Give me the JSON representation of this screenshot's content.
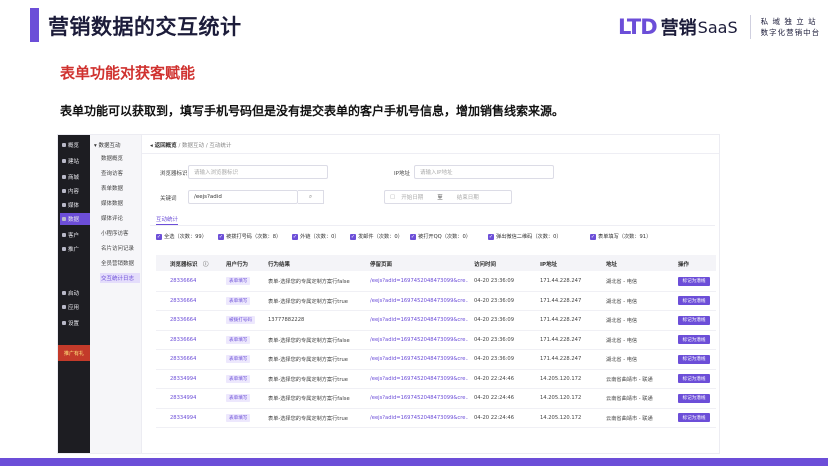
{
  "slide": {
    "title": "营销数据的交互统计",
    "section_title": "表单功能对获客赋能",
    "description": "表单功能可以获取到，填写手机号码但是没有提交表单的客户手机号信息，增加销售线索来源。"
  },
  "logo": {
    "ltd": "LTD",
    "brand": "营销",
    "saas": "SaaS",
    "tagline_1": "私 域 独 立 站",
    "tagline_2": "数字化营销中台"
  },
  "colors": {
    "accent": "#6c4ed8",
    "section_red": "#d0322f"
  },
  "app": {
    "sidebar": [
      {
        "label": "概览",
        "icon": "overview-icon"
      },
      {
        "label": "建站",
        "icon": "site-icon"
      },
      {
        "label": "商城",
        "icon": "shop-icon"
      },
      {
        "label": "内容",
        "icon": "content-icon"
      },
      {
        "label": "媒体",
        "icon": "media-icon"
      },
      {
        "label": "数据",
        "icon": "data-icon",
        "active": true
      },
      {
        "label": "客户",
        "icon": "customer-icon"
      },
      {
        "label": "推广",
        "icon": "promotion-icon"
      },
      {
        "label": "启动",
        "icon": "launch-icon"
      },
      {
        "label": "应用",
        "icon": "app-icon"
      },
      {
        "label": "设置",
        "icon": "settings-icon"
      }
    ],
    "promo_label": "推广有礼",
    "submenu_head": "▾ 数据互动",
    "submenu": [
      "数据概览",
      "查询访客",
      "表单数据",
      "媒体数据",
      "媒体评论",
      "小程序访客",
      "名片访问记录",
      "全员营销数据",
      "交互统计日志"
    ],
    "breadcrumb": {
      "back": "◂ 返回概览",
      "path1": "数据互动",
      "path2": "互动统计"
    },
    "filters": {
      "source_label": "浏览器标识",
      "source_placeholder": "请输入浏览器标识",
      "ip_label": "IP地址",
      "ip_placeholder": "请输入IP地址",
      "keyword_label": "关键词",
      "keyword_value": "/eejs?adid",
      "date_start": "开始日期",
      "date_sep": "至",
      "date_end": "结束日期"
    },
    "tab_label": "互动统计",
    "checks": [
      "全选（次数：99）",
      "被拨打号码（次数：8）",
      "外链（次数：0）",
      "发邮件（次数：0）",
      "被打开QQ（次数：0）",
      "弹出微信二维码（次数：0）",
      "表单填写（次数：91）"
    ],
    "columns": [
      "浏览器标识",
      "用户行为",
      "行为结果",
      "停留页面",
      "访问时间",
      "IP地址",
      "地址",
      "操作"
    ],
    "rows": [
      {
        "id": "28336664",
        "behavior": "表单填写",
        "result": "表单-选择您的专属定制方案行false",
        "page": "/eejs?adid=1697452048473099&cre...",
        "time": "04-20 23:36:09",
        "ip": "171.44.228.247",
        "addr": "湖北省 - 电信",
        "op": "标记为潜线"
      },
      {
        "id": "28336664",
        "behavior": "表单填写",
        "result": "表单-选择您的专属定制方案行true",
        "page": "/eejs?adid=1697452048473099&cre...",
        "time": "04-20 23:36:09",
        "ip": "171.44.228.247",
        "addr": "湖北省 - 电信",
        "op": "标记为潜线"
      },
      {
        "id": "28336664",
        "behavior": "被拨打号码",
        "result": "13777882228",
        "page": "/eejs?adid=1697452048473099&cre...",
        "time": "04-20 23:36:09",
        "ip": "171.44.228.247",
        "addr": "湖北省 - 电信",
        "op": "标记为潜线"
      },
      {
        "id": "28336664",
        "behavior": "表单填写",
        "result": "表单-选择您的专属定制方案行false",
        "page": "/eejs?adid=1697452048473099&cre...",
        "time": "04-20 23:36:09",
        "ip": "171.44.228.247",
        "addr": "湖北省 - 电信",
        "op": "标记为潜线"
      },
      {
        "id": "28336664",
        "behavior": "表单填写",
        "result": "表单-选择您的专属定制方案行true",
        "page": "/eejs?adid=1697452048473099&cre...",
        "time": "04-20 23:36:09",
        "ip": "171.44.228.247",
        "addr": "湖北省 - 电信",
        "op": "标记为潜线"
      },
      {
        "id": "28334994",
        "behavior": "表单填写",
        "result": "表单-选择您的专属定制方案行true",
        "page": "/eejs?adid=1697452048473099&cre...",
        "time": "04-20 22:24:46",
        "ip": "14.205.120.172",
        "addr": "云南省曲靖市 - 联通",
        "op": "标记为潜线"
      },
      {
        "id": "28334994",
        "behavior": "表单填写",
        "result": "表单-选择您的专属定制方案行false",
        "page": "/eejs?adid=1697452048473099&cre...",
        "time": "04-20 22:24:46",
        "ip": "14.205.120.172",
        "addr": "云南省曲靖市 - 联通",
        "op": "标记为潜线"
      },
      {
        "id": "28334994",
        "behavior": "表单填写",
        "result": "表单-选择您的专属定制方案行true",
        "page": "/eejs?adid=1697452048473099&cre...",
        "time": "04-20 22:24:46",
        "ip": "14.205.120.172",
        "addr": "云南省曲靖市 - 联通",
        "op": "标记为潜线"
      }
    ]
  }
}
